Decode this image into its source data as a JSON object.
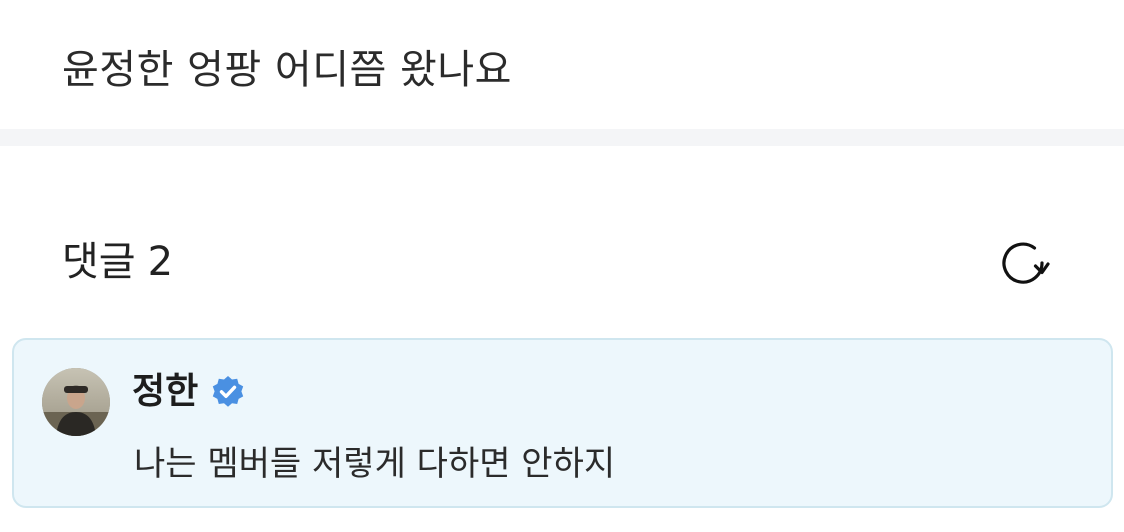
{
  "post": {
    "text": "윤정한 엉팡 어디쯤 왔나요"
  },
  "comments": {
    "title": "댓글",
    "count": "2",
    "refresh_icon": "refresh-icon",
    "items": [
      {
        "author": "정한",
        "verified": true,
        "avatar_icon": "avatar-photo",
        "text": "나는 멤버들 저렇게 다하면 안하지"
      }
    ]
  },
  "colors": {
    "card_background": "#edf7fc",
    "card_border": "#cfe6ef",
    "verified_badge": "#4a90e2",
    "divider": "#f4f5f7"
  }
}
